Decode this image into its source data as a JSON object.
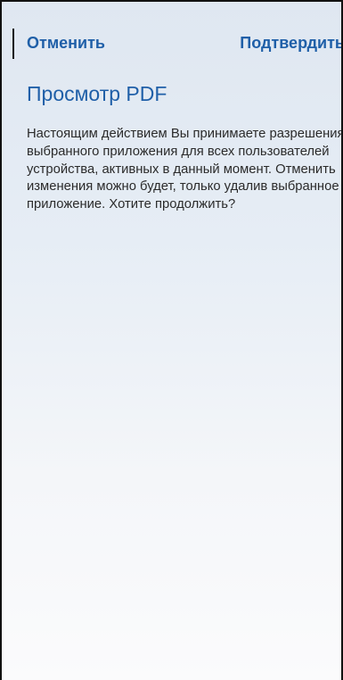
{
  "dialog": {
    "cancel_label": "Отменить",
    "confirm_label": "Подтвердить",
    "title": "Просмотр PDF",
    "message": "Настоящим действием Вы принимаете разрешения выбранного приложения для всех пользователей устройства, активных в данный момент. Отменить изменения можно будет, только удалив выбранное приложение. Хотите продолжить?"
  },
  "colors": {
    "accent": "#1f5fa8",
    "text": "#2b2b2b"
  }
}
